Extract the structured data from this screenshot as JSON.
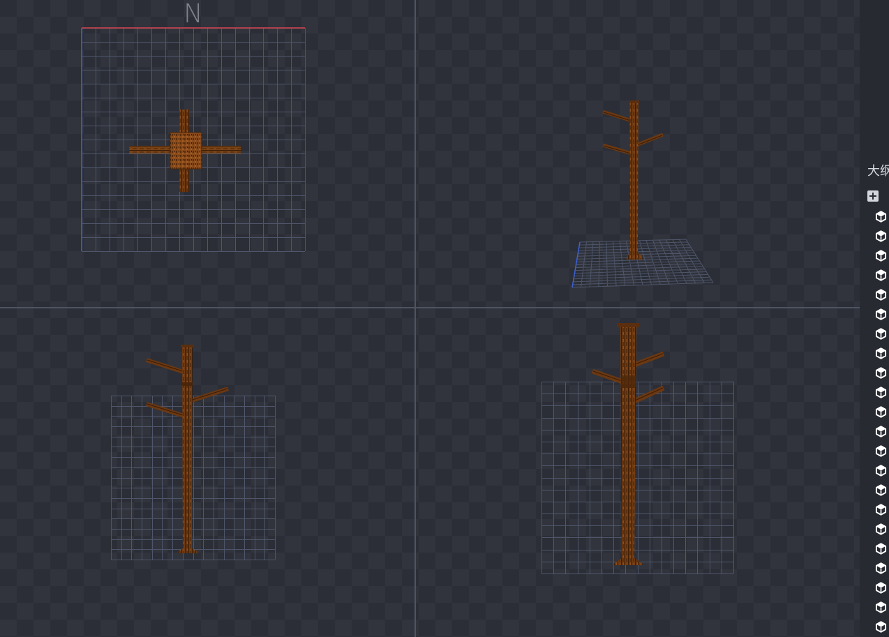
{
  "top_view": {
    "compass_label": "N"
  },
  "outliner": {
    "title": "大纲",
    "add_icon": "plus-icon",
    "items": [
      {
        "icon": "cube-icon"
      },
      {
        "icon": "cube-icon"
      },
      {
        "icon": "cube-icon"
      },
      {
        "icon": "cube-icon"
      },
      {
        "icon": "cube-icon"
      },
      {
        "icon": "cube-icon"
      },
      {
        "icon": "cube-icon"
      },
      {
        "icon": "cube-icon"
      },
      {
        "icon": "cube-icon"
      },
      {
        "icon": "cube-icon"
      },
      {
        "icon": "cube-icon"
      },
      {
        "icon": "cube-icon"
      },
      {
        "icon": "cube-icon"
      },
      {
        "icon": "cube-icon"
      },
      {
        "icon": "cube-icon"
      },
      {
        "icon": "cube-icon"
      },
      {
        "icon": "cube-icon"
      },
      {
        "icon": "cube-icon"
      },
      {
        "icon": "cube-icon"
      },
      {
        "icon": "cube-icon"
      },
      {
        "icon": "cube-icon"
      },
      {
        "icon": "cube-icon"
      }
    ]
  },
  "colors": {
    "background": "#2b2e36",
    "checker": "#31343c",
    "divider": "#4f5462",
    "grid": "#4f566b",
    "axis_x": "#d9434f",
    "axis_z": "#3b62d6",
    "wood": "#6b3812",
    "sidebar": "#272a31",
    "text": "#d6d9df"
  }
}
